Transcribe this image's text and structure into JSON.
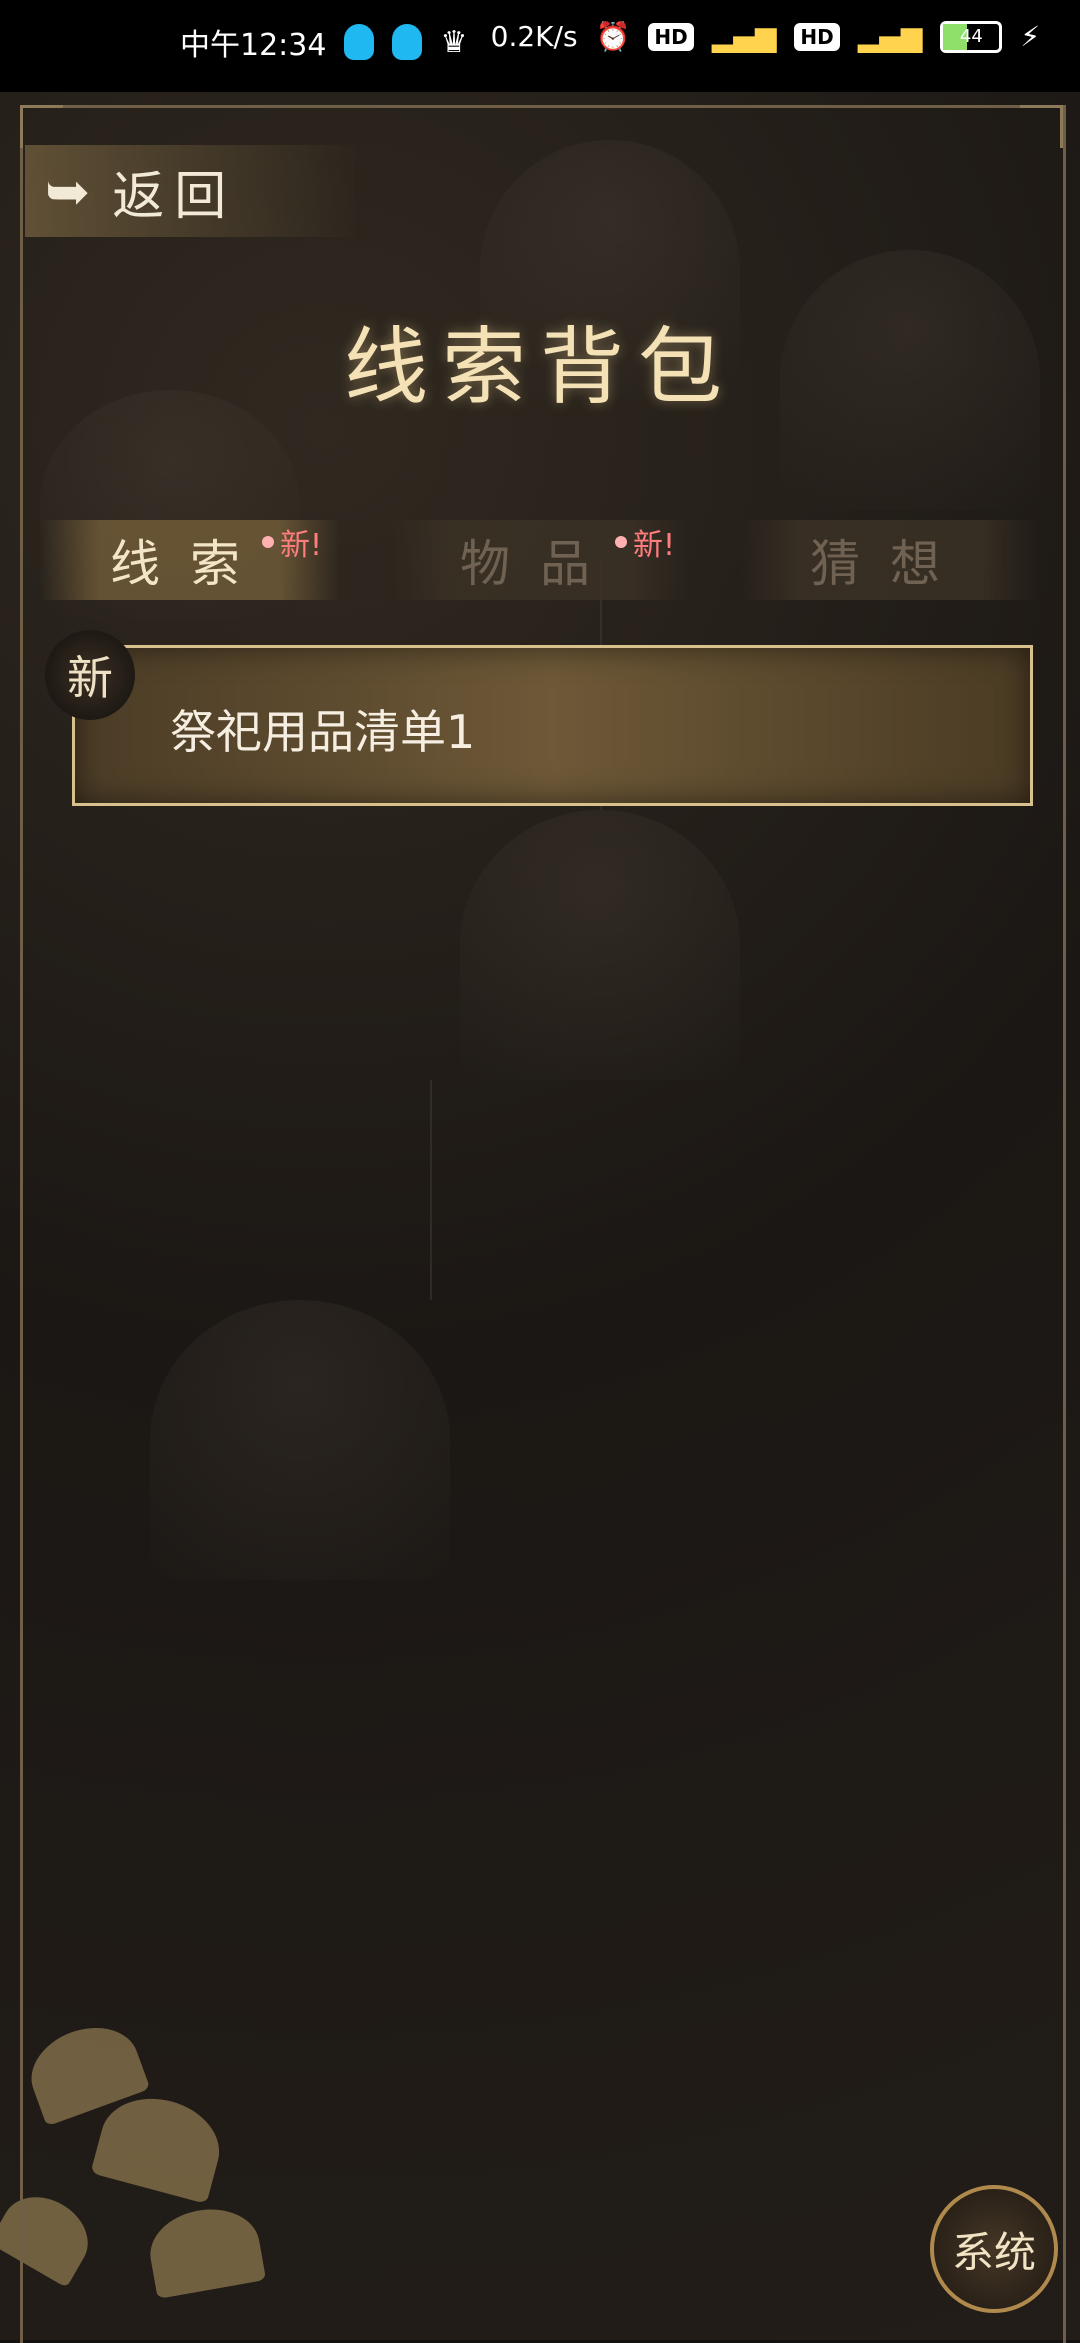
{
  "status_bar": {
    "time": "中午12:34",
    "network_speed": "0.2K/s",
    "hd_label": "HD",
    "battery": "44",
    "icons": [
      "qq-icon",
      "qq-icon",
      "notification-icon",
      "alarm-icon",
      "signal-icon",
      "battery-icon",
      "charging-icon"
    ]
  },
  "header": {
    "back_label": "返回",
    "title": "线索背包"
  },
  "tabs": [
    {
      "label": "线索",
      "badge": "新!",
      "active": true
    },
    {
      "label": "物品",
      "badge": "新!",
      "active": false
    },
    {
      "label": "猜想",
      "badge": "",
      "active": false
    }
  ],
  "clues": [
    {
      "tag": "新",
      "label": "祭祀用品清单1"
    }
  ],
  "footer": {
    "system_label": "系统"
  },
  "colors": {
    "accent_gold": "#d8c18d",
    "badge_red": "#ff7d7d",
    "background": "#141210"
  }
}
